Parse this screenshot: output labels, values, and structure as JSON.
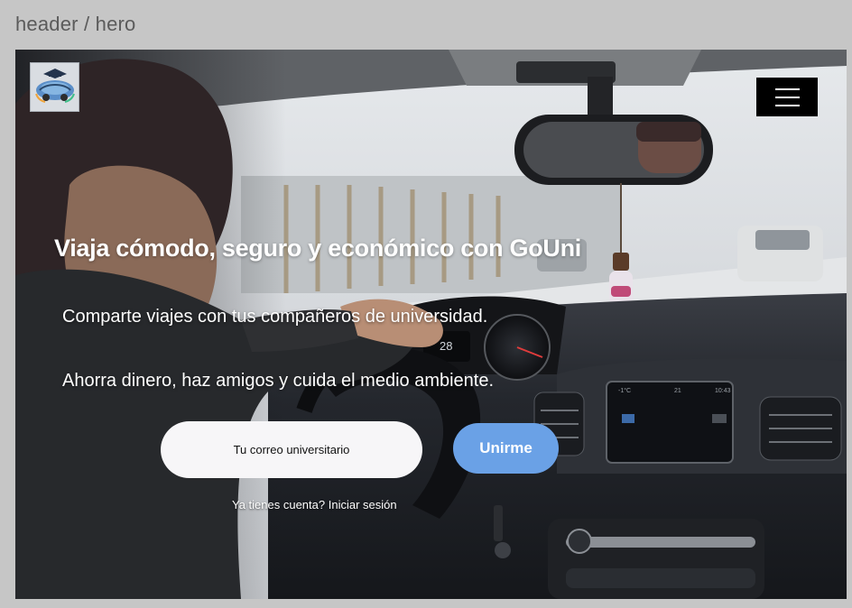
{
  "frame": {
    "label": "header / hero"
  },
  "header": {
    "logo_name": "gouni-logo",
    "menu_icon": "hamburger-icon"
  },
  "hero": {
    "title": "Viaja cómodo, seguro y económico con GoUni",
    "subtitle_1": "Comparte viajes con tus compañeros de universidad.",
    "subtitle_2": "Ahorra dinero, haz amigos y cuida el medio ambiente.",
    "email_placeholder": "Tu correo universitario",
    "join_label": "Unirme",
    "login_prompt": "Ya tienes cuenta?",
    "login_link": "Iniciar sesión"
  },
  "dashboard_display": {
    "speed": "28",
    "screen_temp": "-1°C",
    "screen_day": "21",
    "screen_time": "10:43"
  },
  "colors": {
    "frame_bg": "#c6c6c6",
    "join_button": "#6aa1e6",
    "input_bg": "#f7f6f8",
    "menu_button": "#000000"
  }
}
